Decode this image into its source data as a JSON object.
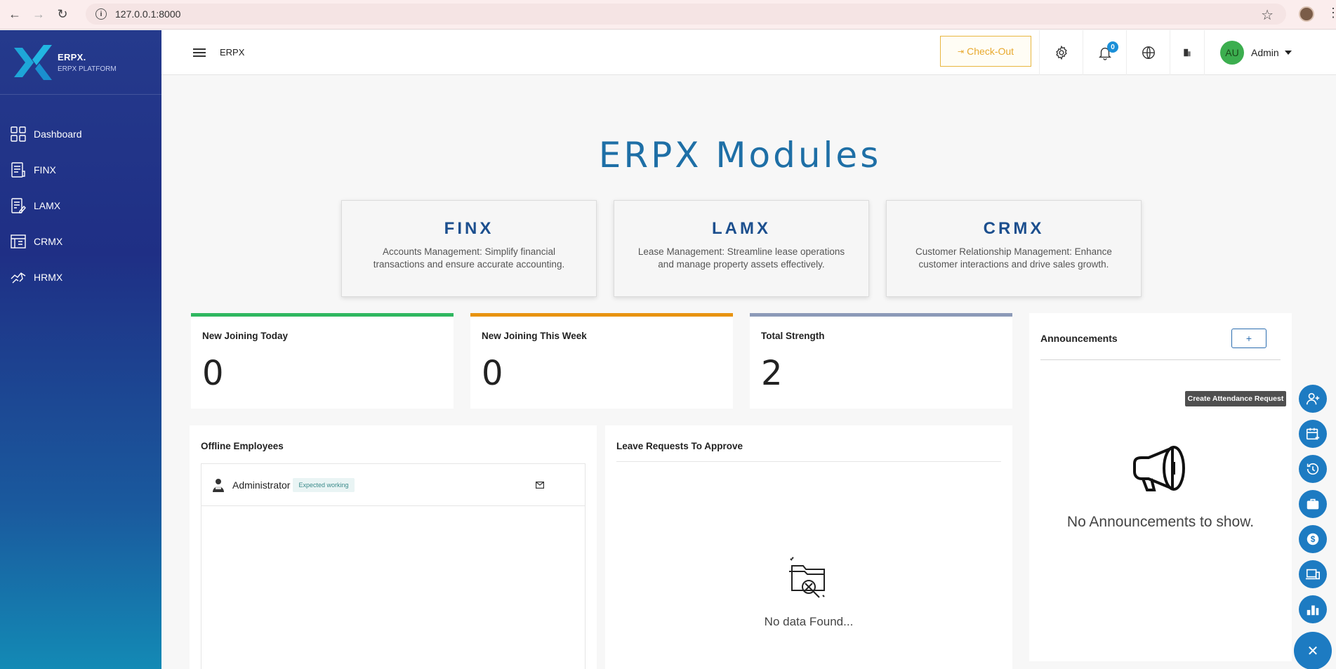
{
  "browser": {
    "url": "127.0.0.1:8000"
  },
  "sidebar": {
    "brand_title": "ERPX.",
    "brand_subtitle": "ERPX PLATFORM",
    "items": [
      {
        "label": "Dashboard",
        "icon": "grid-icon"
      },
      {
        "label": "FINX",
        "icon": "document-icon"
      },
      {
        "label": "LAMX",
        "icon": "edit-document-icon"
      },
      {
        "label": "CRMX",
        "icon": "building-icon"
      },
      {
        "label": "HRMX",
        "icon": "handshake-icon"
      }
    ]
  },
  "header": {
    "title": "ERPX",
    "checkout_label": "Check-Out",
    "notification_count": "0",
    "user_initials": "AU",
    "user_name": "Admin"
  },
  "main": {
    "heading": "ERPX Modules",
    "modules": [
      {
        "title": "FINX",
        "description": "Accounts Management: Simplify financial transactions and ensure accurate accounting."
      },
      {
        "title": "LAMX",
        "description": "Lease Management: Streamline lease operations and manage property assets effectively."
      },
      {
        "title": "CRMX",
        "description": "Customer Relationship Management: Enhance customer interactions and drive sales growth."
      }
    ],
    "stats": [
      {
        "label": "New Joining Today",
        "value": "0",
        "color": "#2fb760"
      },
      {
        "label": "New Joining This Week",
        "value": "0",
        "color": "#e8930f"
      },
      {
        "label": "Total Strength",
        "value": "2",
        "color": "#8c9ab8"
      }
    ],
    "offline": {
      "title": "Offline Employees",
      "employee_name": "Administrator",
      "employee_status": "Expected working"
    },
    "leave": {
      "title": "Leave Requests To Approve",
      "empty_text": "No data Found..."
    },
    "announcements": {
      "title": "Announcements",
      "add_label": "+",
      "empty_text": "No Announcements to show."
    },
    "tooltip": "Create Attendance Request"
  },
  "quick_actions": [
    {
      "icon": "user-add-icon"
    },
    {
      "icon": "calendar-add-icon"
    },
    {
      "icon": "history-icon"
    },
    {
      "icon": "briefcase-icon"
    },
    {
      "icon": "dollar-icon"
    },
    {
      "icon": "devices-icon"
    },
    {
      "icon": "chart-icon"
    }
  ],
  "colors": {
    "accent": "#1d7bc2",
    "heading": "#1e6fa6",
    "checkout": "#e8a92e"
  }
}
